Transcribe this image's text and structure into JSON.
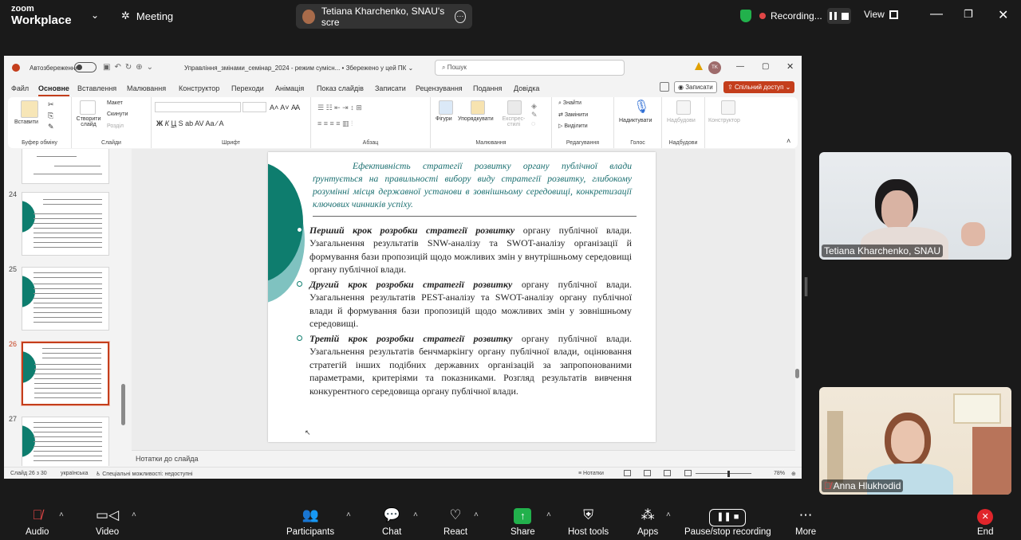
{
  "zoom": {
    "brand_top": "zoom",
    "brand_bottom": "Workplace",
    "meeting_label": "Meeting",
    "share_label": "Tetiana Kharchenko, SNAU's scre",
    "recording_label": "Recording...",
    "view_label": "View",
    "toolbar": {
      "audio": "Audio",
      "video": "Video",
      "participants": "Participants",
      "chat": "Chat",
      "react": "React",
      "share": "Share",
      "host_tools": "Host tools",
      "apps": "Apps",
      "pause_stop": "Pause/stop recording",
      "more": "More",
      "end": "End"
    },
    "participants": [
      {
        "name": "Tetiana Kharchenko, SNAU"
      },
      {
        "name": "Anna Hlukhodid"
      }
    ]
  },
  "ppt": {
    "autosave": "Автозбереження",
    "file_title": "Управління_змінами_семінар_2024  -  режим сумісн...  •  Збережено у цей ПК ⌄",
    "search_placeholder": "Пошук",
    "user_initials": "TK",
    "menu": [
      "Файл",
      "Основне",
      "Вставлення",
      "Малювання",
      "Конструктор",
      "Переходи",
      "Анімація",
      "Показ слайдів",
      "Записати",
      "Рецензування",
      "Подання",
      "Довідка"
    ],
    "record_btn": "Записати",
    "share_btn": "Спільний доступ",
    "ribbon": {
      "paste": "Вставити",
      "new_slide": "Створити слайд",
      "layout": "Макет",
      "reset": "Скинути",
      "sections": "Розділ",
      "shapes": "Фігури",
      "arrange": "Упорядкувати",
      "quick_styles": "Експрес-стилі",
      "find": "Знайти",
      "replace": "Замінити",
      "select": "Виділити",
      "dictate": "Надиктувати",
      "addins": "Надбудови",
      "designer": "Конструктор",
      "groups": {
        "clipboard": "Буфер обміну",
        "slides": "Слайди",
        "font": "Шрифт",
        "paragraph": "Абзац",
        "drawing": "Малювання",
        "editing": "Редагування",
        "voice": "Голос",
        "addins": "Надбудови"
      }
    },
    "thumb_numbers": [
      "24",
      "25",
      "26",
      "27"
    ],
    "notes_placeholder": "Нотатки до слайда",
    "status": {
      "slide": "Слайд 26 з 30",
      "lang": "українська",
      "access": "Спеціальні можливості: недоступні",
      "notes": "Нотатки",
      "zoom": "78%"
    }
  },
  "slide": {
    "intro": "Ефективність стратегії розвитку органу публічної влади ґрунтується на правильності вибору виду стратегії розвитку, глибокому розумінні місця державної установи в зовнішньому середовищі, конкретизації ключових чинників успіху.",
    "bullets": [
      {
        "lead": "Перший крок розробки стратегії розвитку",
        "rest": " органу публічної влади. Узагальнення результатів SNW-аналізу та SWOT-аналізу організації й формування бази пропозицій щодо можливих змін у внутрішньому середовищі органу публічної влади."
      },
      {
        "lead": "Другий крок розробки стратегії розвитку",
        "rest": " органу публічної влади. Узагальнення результатів PEST-аналізу та SWOT-аналізу органу публічної влади й формування бази пропозицій щодо можливих змін у зовнішньому середовищі."
      },
      {
        "lead": "Третій крок розробки стратегії розвитку",
        "rest": " органу публічної влади. Узагальнення результатів бенчмаркінгу органу публічної влади, оцінювання стратегій інших подібних державних організацій за запропонованими параметрами, критеріями та показниками. Розгляд результатів вивчення конкурентного середовища органу публічної влади."
      }
    ]
  },
  "colors": {
    "ppt_accent": "#c43e1c",
    "slide_teal": "#0e7d6e",
    "zoom_green": "#22b14c",
    "end_red": "#e0252b"
  }
}
